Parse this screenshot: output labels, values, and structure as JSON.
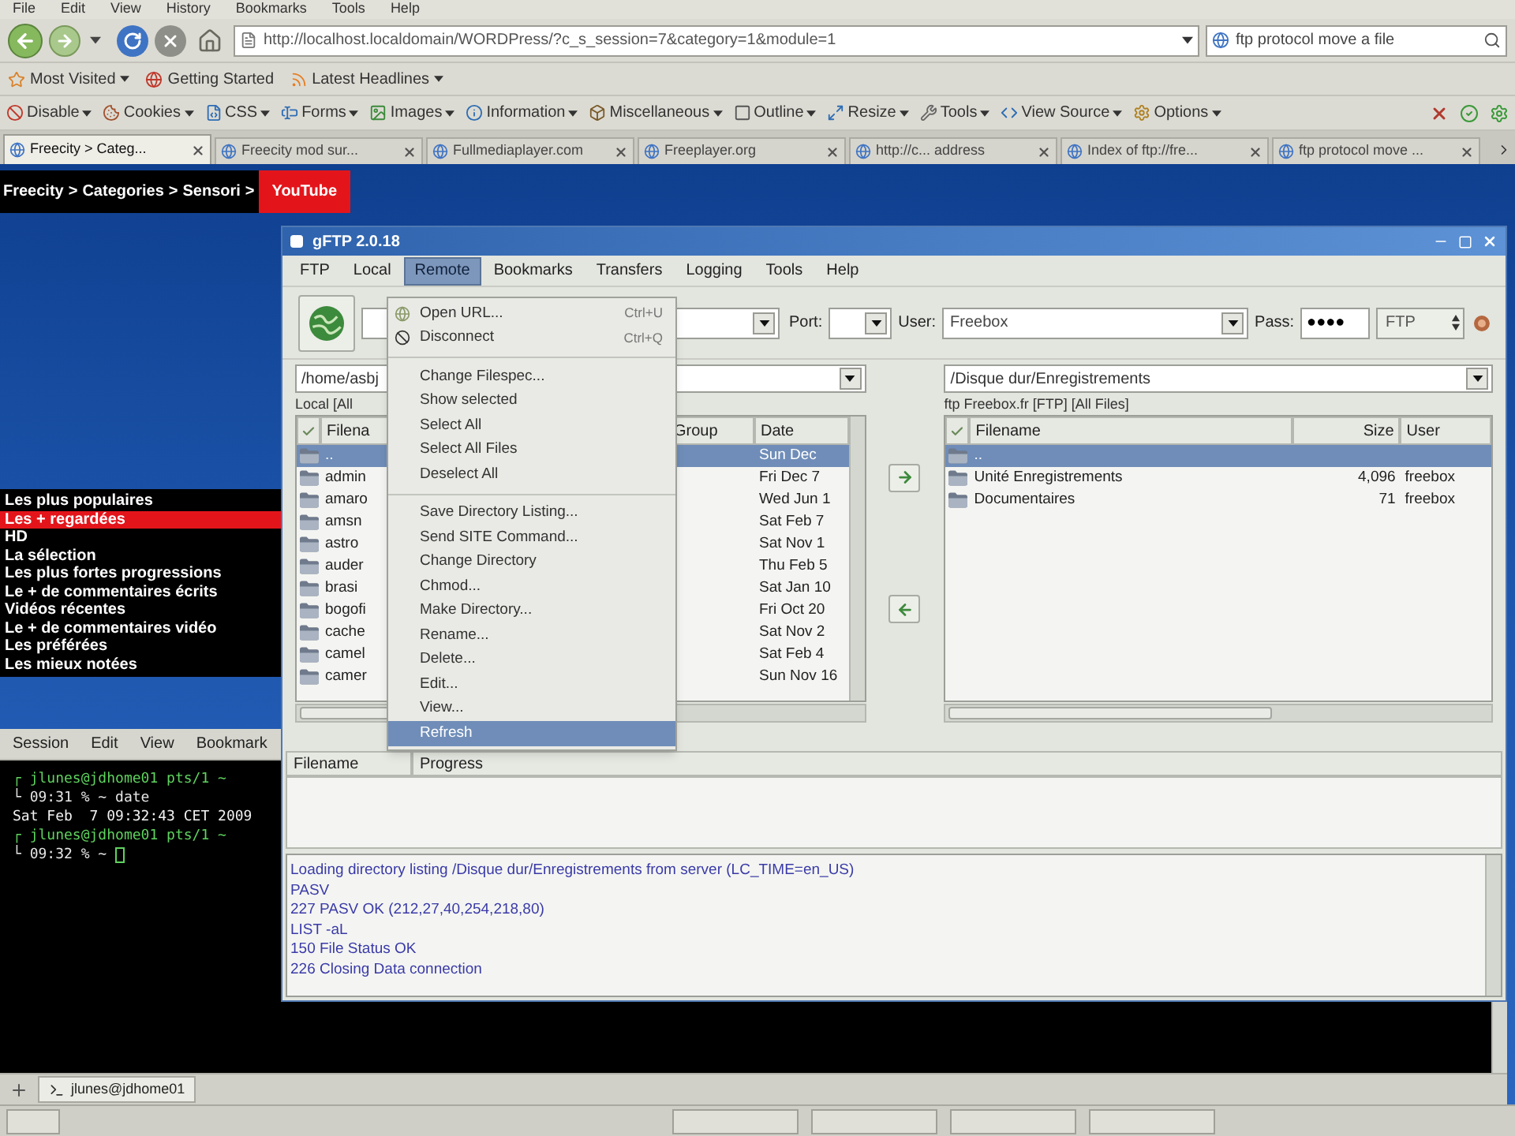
{
  "browser": {
    "menu": [
      "File",
      "Edit",
      "View",
      "History",
      "Bookmarks",
      "Tools",
      "Help"
    ],
    "url": "http://localhost.localdomain/WORDPress/?c_s_session=7&category=1&module=1",
    "search": "ftp protocol move a file",
    "bookmarks": [
      {
        "label": "Most Visited",
        "dropdown": true
      },
      {
        "label": "Getting Started",
        "dropdown": false
      },
      {
        "label": "Latest Headlines",
        "dropdown": true
      }
    ],
    "dev_toolbar": [
      "Disable",
      "Cookies",
      "CSS",
      "Forms",
      "Images",
      "Information",
      "Miscellaneous",
      "Outline",
      "Resize",
      "Tools",
      "View Source",
      "Options"
    ],
    "tabs": [
      {
        "label": "Freecity > Categ...",
        "selected": true
      },
      {
        "label": "Freecity mod sur...",
        "selected": false
      },
      {
        "label": "Fullmediaplayer.com",
        "selected": false
      },
      {
        "label": "Freeplayer.org",
        "selected": false
      },
      {
        "label": "http://c... address",
        "selected": false
      },
      {
        "label": "Index of ftp://fre...",
        "selected": false
      },
      {
        "label": "ftp protocol move ...",
        "selected": false
      }
    ]
  },
  "page": {
    "breadcrumb": [
      {
        "kind": "link",
        "label": "Freecity",
        "current": false
      },
      {
        "kind": "separator",
        "label": ">"
      },
      {
        "kind": "link",
        "label": "Categories",
        "current": false
      },
      {
        "kind": "separator",
        "label": ">"
      },
      {
        "kind": "link",
        "label": "Sensori",
        "current": false
      },
      {
        "kind": "separator",
        "label": ">"
      },
      {
        "kind": "link",
        "label": "YouTube",
        "current": true
      }
    ],
    "categories": [
      {
        "label": "Les plus populaires",
        "selected": false
      },
      {
        "label": "Les + regardées",
        "selected": true
      },
      {
        "label": "HD",
        "selected": false
      },
      {
        "label": "La sélection",
        "selected": false
      },
      {
        "label": "Les plus fortes progressions",
        "selected": false
      },
      {
        "label": "Le + de commentaires écrits",
        "selected": false
      },
      {
        "label": "Vidéos récentes",
        "selected": false
      },
      {
        "label": "Le + de commentaires vidéo",
        "selected": false
      },
      {
        "label": "Les préférées",
        "selected": false
      },
      {
        "label": "Les mieux notées",
        "selected": false
      }
    ]
  },
  "terminal": {
    "menu": [
      "Session",
      "Edit",
      "View",
      "Bookmark"
    ],
    "lines": [
      {
        "kind": "prompt",
        "text": "┌ jlunes@jdhome01 pts/1 ~",
        "cursor": false
      },
      {
        "kind": "command",
        "text": "└ 09:31 % ~ date",
        "cursor": false
      },
      {
        "kind": "output",
        "text": "Sat Feb  7 09:32:43 CET 2009",
        "cursor": false
      },
      {
        "kind": "prompt",
        "text": "┌ jlunes@jdhome01 pts/1 ~",
        "cursor": false
      },
      {
        "kind": "command",
        "text": "└ 09:32 % ~",
        "cursor": true
      }
    ],
    "tab": "jlunes@jdhome01"
  },
  "gftp": {
    "title": "gFTP 2.0.18",
    "menu": [
      {
        "label": "FTP",
        "selected": false
      },
      {
        "label": "Local",
        "selected": false
      },
      {
        "label": "Remote",
        "selected": true
      },
      {
        "label": "Bookmarks",
        "selected": false
      },
      {
        "label": "Transfers",
        "selected": false
      },
      {
        "label": "Logging",
        "selected": false
      },
      {
        "label": "Tools",
        "selected": false
      },
      {
        "label": "Help",
        "selected": false
      }
    ],
    "toolbar": {
      "port_label": "Port:",
      "user_label": "User:",
      "user": "Freebox",
      "pass_label": "Pass:",
      "pass": "●●●●",
      "protocol": "FTP"
    },
    "local": {
      "path": "/home/asbj",
      "status": "Local [All",
      "columns": [
        "Filena",
        "Group",
        "Date"
      ],
      "rows": [
        {
          "name": "..",
          "date": "Sun Dec",
          "selected": true
        },
        {
          "name": "admin",
          "date": "Fri Dec 7",
          "selected": false
        },
        {
          "name": "amaro",
          "date": "Wed Jun 1",
          "selected": false
        },
        {
          "name": "amsn",
          "date": "Sat Feb 7",
          "selected": false
        },
        {
          "name": "astro",
          "date": "Sat Nov 1",
          "selected": false
        },
        {
          "name": "auder",
          "date": "Thu Feb 5",
          "selected": false
        },
        {
          "name": "brasi",
          "date": "Sat Jan 10",
          "selected": false
        },
        {
          "name": "bogofi",
          "date": "Fri Oct 20",
          "selected": false
        },
        {
          "name": "cache",
          "date": "Sat Nov 2",
          "selected": false
        },
        {
          "name": "camel",
          "date": "Sat Feb 4",
          "selected": false
        },
        {
          "name": "camer",
          "date": "Sun Nov 16",
          "selected": false
        }
      ]
    },
    "remote": {
      "path": "/Disque dur/Enregistrements",
      "status": "ftp Freebox.fr [FTP] [All Files]",
      "columns": [
        "Filename",
        "Size",
        "User"
      ],
      "rows": [
        {
          "name": "..",
          "selected": true
        },
        {
          "name": "Unité Enregistrements",
          "size": "4,096",
          "user": "freebox",
          "selected": false
        },
        {
          "name": "Documentaires",
          "size": "71",
          "user": "freebox",
          "selected": false
        }
      ]
    },
    "remote_menu": [
      [
        {
          "kind": "icon",
          "label": "Open URL...",
          "shortcut": "Ctrl+U",
          "selected": false
        },
        {
          "kind": "icon",
          "label": "Disconnect",
          "shortcut": "Ctrl+Q",
          "selected": false
        }
      ],
      [
        {
          "kind": "plain",
          "label": "Change Filespec...",
          "selected": false
        },
        {
          "kind": "plain",
          "label": "Show selected",
          "selected": false
        },
        {
          "kind": "plain",
          "label": "Select All",
          "selected": false
        },
        {
          "kind": "plain",
          "label": "Select All Files",
          "selected": false
        },
        {
          "kind": "plain",
          "label": "Deselect All",
          "selected": false
        }
      ],
      [
        {
          "kind": "plain",
          "label": "Save Directory Listing...",
          "selected": false
        },
        {
          "kind": "plain",
          "label": "Send SITE Command...",
          "selected": false
        },
        {
          "kind": "plain",
          "label": "Change Directory",
          "selected": false
        },
        {
          "kind": "plain",
          "label": "Chmod...",
          "selected": false
        },
        {
          "kind": "plain",
          "label": "Make Directory...",
          "selected": false
        },
        {
          "kind": "plain",
          "label": "Rename...",
          "selected": false
        },
        {
          "kind": "plain",
          "label": "Delete...",
          "selected": false
        },
        {
          "kind": "plain",
          "label": "Edit...",
          "selected": false
        },
        {
          "kind": "plain",
          "label": "View...",
          "selected": false
        },
        {
          "kind": "plain",
          "label": "Refresh",
          "selected": true
        }
      ]
    ],
    "transfer_columns": [
      "Filename",
      "Progress"
    ],
    "log": [
      "Loading directory listing /Disque dur/Enregistrements from server (LC_TIME=en_US)",
      "PASV",
      "227 PASV OK (212,27,40,254,218,80)",
      "LIST -aL",
      "150 File Status OK",
      "226 Closing Data connection"
    ]
  }
}
